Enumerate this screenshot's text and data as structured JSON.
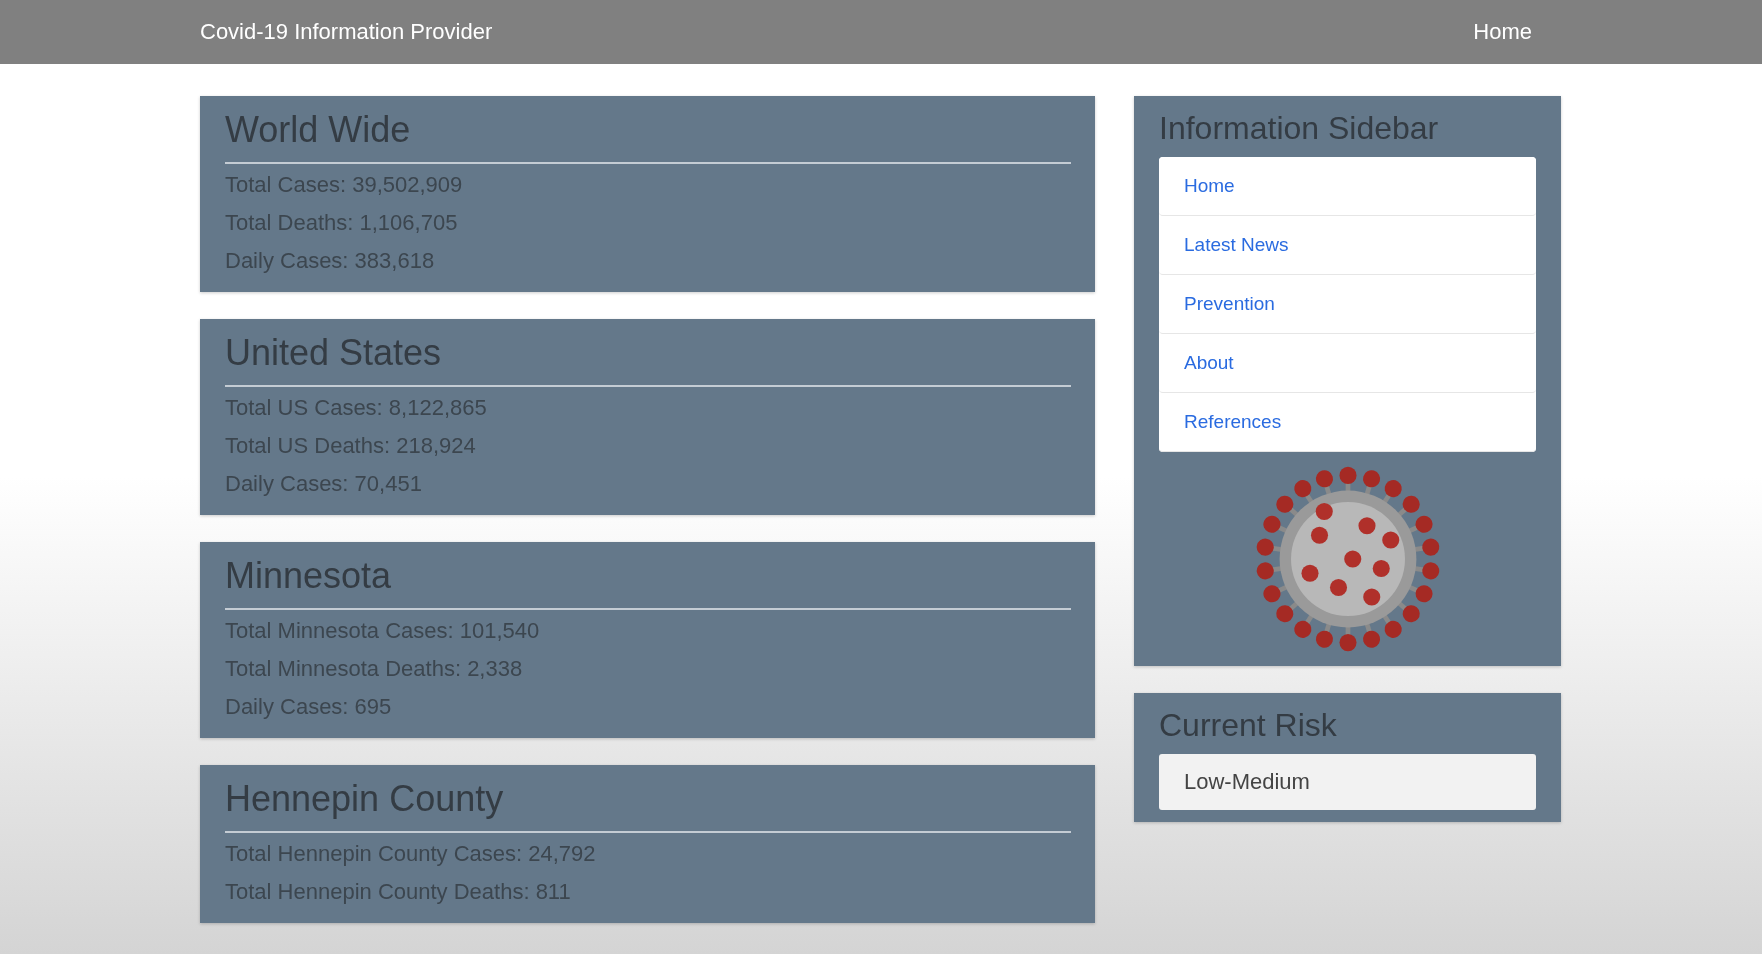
{
  "navbar": {
    "brand": "Covid-19 Information Provider",
    "link": "Home"
  },
  "stat_cards": [
    {
      "title": "World Wide",
      "lines": [
        "Total Cases: 39,502,909",
        "Total Deaths: 1,106,705",
        "Daily Cases: 383,618"
      ]
    },
    {
      "title": "United States",
      "lines": [
        "Total US Cases: 8,122,865",
        "Total US Deaths: 218,924",
        "Daily Cases: 70,451"
      ]
    },
    {
      "title": "Minnesota",
      "lines": [
        "Total Minnesota Cases: 101,540",
        "Total Minnesota Deaths: 2,338",
        "Daily Cases: 695"
      ]
    },
    {
      "title": "Hennepin County",
      "lines": [
        "Total Hennepin County Cases: 24,792",
        "Total Hennepin County Deaths: 811"
      ]
    }
  ],
  "sidebar": {
    "title": "Information Sidebar",
    "links": [
      "Home",
      "Latest News",
      "Prevention",
      "About",
      "References"
    ]
  },
  "risk": {
    "title": "Current Risk",
    "value": "Low-Medium"
  }
}
